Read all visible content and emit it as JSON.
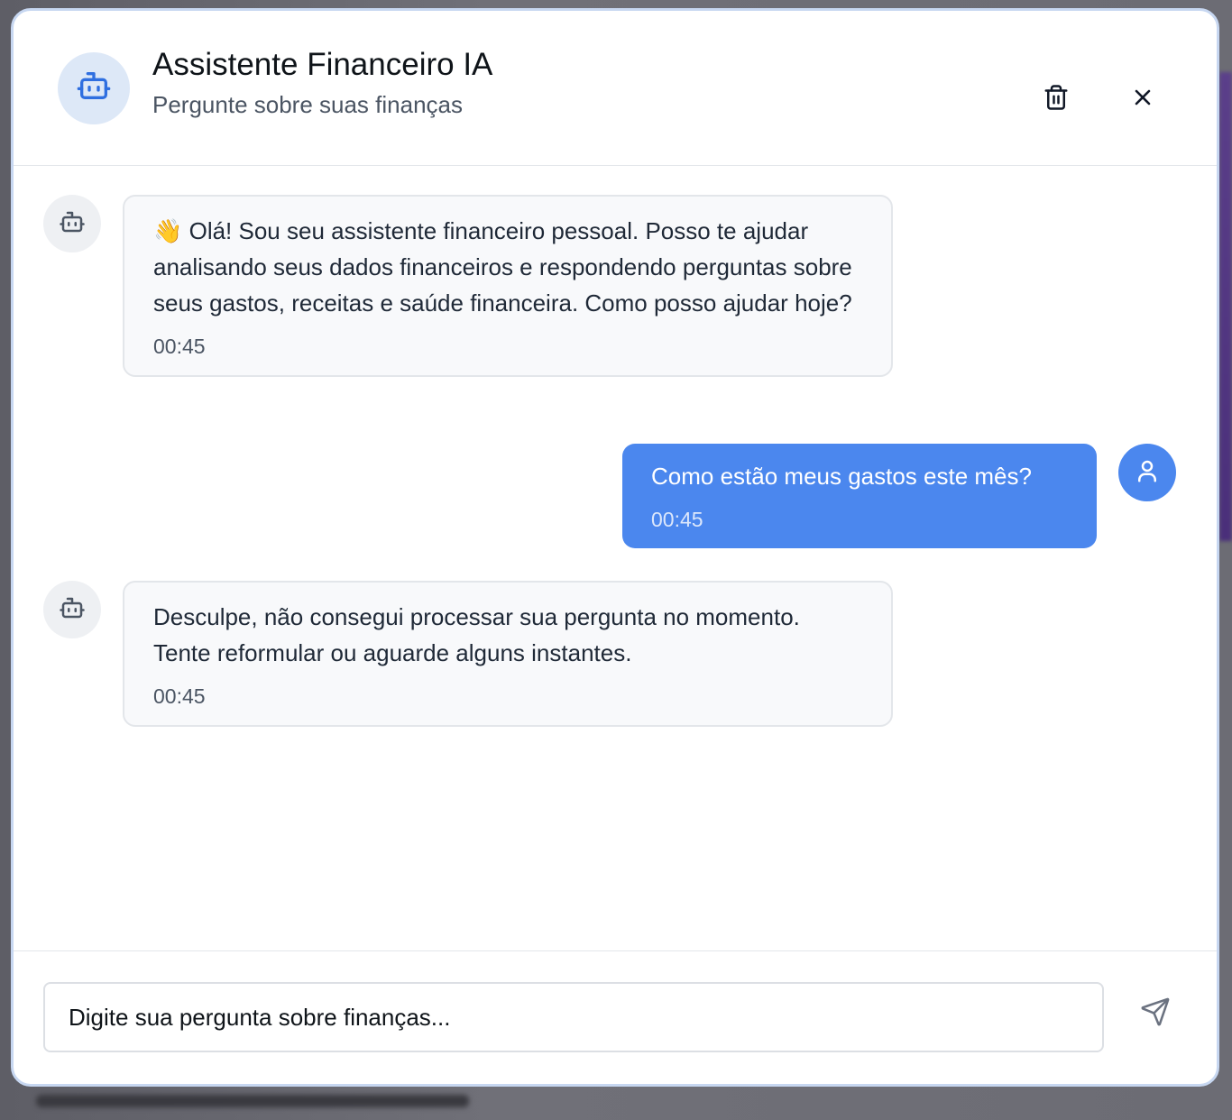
{
  "header": {
    "title": "Assistente Financeiro IA",
    "subtitle": "Pergunte sobre suas finanças",
    "avatar_icon": "bot-icon",
    "actions": [
      {
        "name": "clear-chat-button",
        "icon": "trash-icon"
      },
      {
        "name": "close-button",
        "icon": "close-icon"
      }
    ]
  },
  "messages": [
    {
      "role": "assistant",
      "text": "👋 Olá! Sou seu assistente financeiro pessoal. Posso te ajudar analisando seus dados financeiros e respondendo perguntas sobre seus gastos, receitas e saúde financeira. Como posso ajudar hoje?",
      "time": "00:45",
      "icon": "bot-icon"
    },
    {
      "role": "user",
      "text": "Como estão meus gastos este mês?",
      "time": "00:45",
      "icon": "user-icon"
    },
    {
      "role": "assistant",
      "text": "Desculpe, não consegui processar sua pergunta no momento. Tente reformular ou aguarde alguns instantes.",
      "time": "00:45",
      "icon": "bot-icon"
    }
  ],
  "composer": {
    "placeholder": "Digite sua pergunta sobre finanças...",
    "value": "",
    "send_icon": "send-icon"
  },
  "colors": {
    "accent": "#4b87ee",
    "bot_bubble_bg": "#f8f9fb",
    "bot_icon": "#2f6fe0",
    "modal_border": "#c7d7f1"
  }
}
